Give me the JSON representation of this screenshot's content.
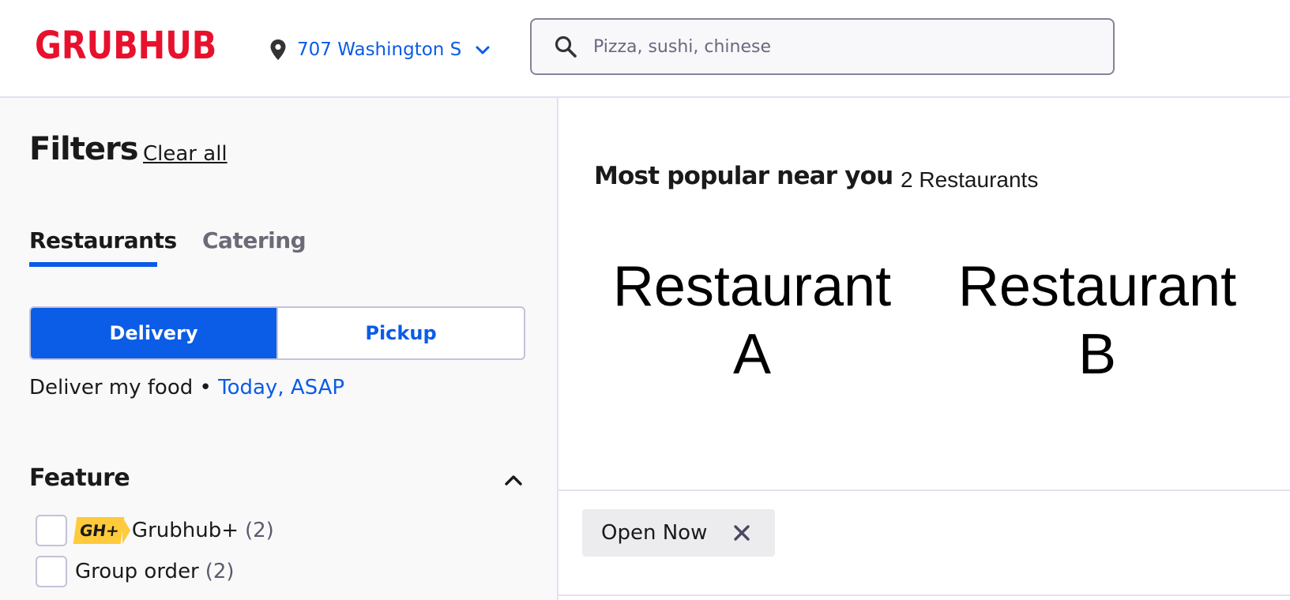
{
  "header": {
    "logo_text": "GRUBHUB",
    "address": "707 Washington S",
    "search_placeholder": "Pizza, sushi, chinese"
  },
  "sidebar": {
    "title": "Filters",
    "clear_all": "Clear all",
    "tabs": [
      {
        "label": "Restaurants",
        "selected": true
      },
      {
        "label": "Catering",
        "selected": false
      }
    ],
    "mode_toggle": {
      "delivery": "Delivery",
      "pickup": "Pickup",
      "selected": "Delivery"
    },
    "deliver_prefix": "Deliver my food • ",
    "deliver_when": "Today, ASAP",
    "feature": {
      "title": "Feature",
      "options": [
        {
          "badge": "GH+",
          "label": "Grubhub+",
          "count": "(2)"
        },
        {
          "label": "Group order",
          "count": "(2)"
        }
      ]
    }
  },
  "main": {
    "heading": "Most popular near you",
    "count": "2 Restaurants",
    "restaurants": [
      {
        "line1": "Restaurant",
        "line2": "A"
      },
      {
        "line1": "Restaurant",
        "line2": "B"
      }
    ],
    "active_filters": [
      {
        "label": "Open Now"
      }
    ]
  },
  "colors": {
    "brand_red": "#e8112d",
    "accent_blue": "#0b5ce6",
    "badge_yellow": "#ffca3b"
  },
  "icons": [
    "location-pin-icon",
    "chevron-down-icon",
    "search-icon",
    "chevron-up-icon",
    "close-icon"
  ]
}
